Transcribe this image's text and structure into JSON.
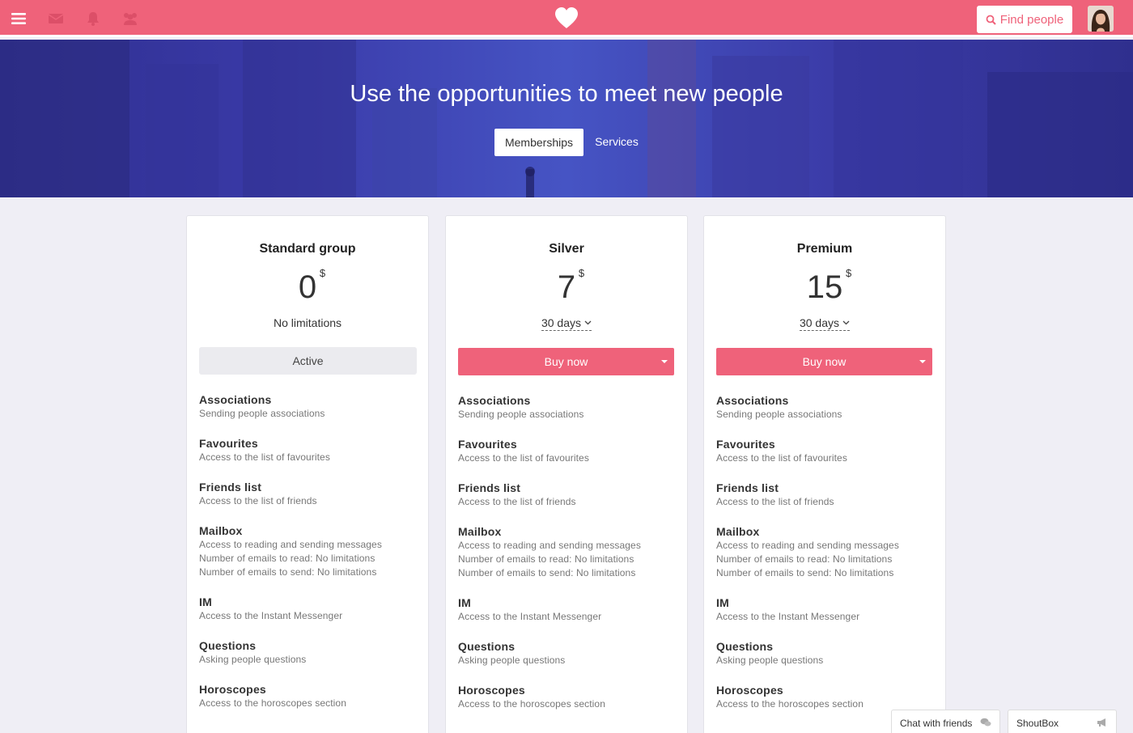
{
  "topbar": {
    "find_label": "Find people",
    "icons": [
      "menu-icon",
      "mail-icon",
      "bell-icon",
      "group-icon",
      "heart-logo-icon",
      "search-icon"
    ],
    "accent": "#ef627a"
  },
  "hero": {
    "title": "Use the opportunities to meet new people",
    "tabs": [
      {
        "label": "Memberships",
        "active": true
      },
      {
        "label": "Services",
        "active": false
      }
    ]
  },
  "plans": [
    {
      "name": "Standard group",
      "price": "0",
      "currency": "$",
      "note": "No limitations",
      "action": "Active",
      "features": [
        {
          "name": "Associations",
          "lines": [
            "Sending people associations"
          ]
        },
        {
          "name": "Favourites",
          "lines": [
            "Access to the list of favourites"
          ]
        },
        {
          "name": "Friends list",
          "lines": [
            "Access to the list of friends"
          ]
        },
        {
          "name": "Mailbox",
          "lines": [
            "Access to reading and sending messages",
            "Number of emails to read: No limitations",
            "Number of emails to send: No limitations"
          ]
        },
        {
          "name": "IM",
          "lines": [
            "Access to the Instant Messenger"
          ]
        },
        {
          "name": "Questions",
          "lines": [
            "Asking people questions"
          ]
        },
        {
          "name": "Horoscopes",
          "lines": [
            "Access to the horoscopes section"
          ]
        }
      ]
    },
    {
      "name": "Silver",
      "price": "7",
      "currency": "$",
      "period": "30 days",
      "action": "Buy now",
      "features": [
        {
          "name": "Associations",
          "lines": [
            "Sending people associations"
          ]
        },
        {
          "name": "Favourites",
          "lines": [
            "Access to the list of favourites"
          ]
        },
        {
          "name": "Friends list",
          "lines": [
            "Access to the list of friends"
          ]
        },
        {
          "name": "Mailbox",
          "lines": [
            "Access to reading and sending messages",
            "Number of emails to read: No limitations",
            "Number of emails to send: No limitations"
          ]
        },
        {
          "name": "IM",
          "lines": [
            "Access to the Instant Messenger"
          ]
        },
        {
          "name": "Questions",
          "lines": [
            "Asking people questions"
          ]
        },
        {
          "name": "Horoscopes",
          "lines": [
            "Access to the horoscopes section"
          ]
        }
      ]
    },
    {
      "name": "Premium",
      "price": "15",
      "currency": "$",
      "period": "30 days",
      "action": "Buy now",
      "features": [
        {
          "name": "Associations",
          "lines": [
            "Sending people associations"
          ]
        },
        {
          "name": "Favourites",
          "lines": [
            "Access to the list of favourites"
          ]
        },
        {
          "name": "Friends list",
          "lines": [
            "Access to the list of friends"
          ]
        },
        {
          "name": "Mailbox",
          "lines": [
            "Access to reading and sending messages",
            "Number of emails to read: No limitations",
            "Number of emails to send: No limitations"
          ]
        },
        {
          "name": "IM",
          "lines": [
            "Access to the Instant Messenger"
          ]
        },
        {
          "name": "Questions",
          "lines": [
            "Asking people questions"
          ]
        },
        {
          "name": "Horoscopes",
          "lines": [
            "Access to the horoscopes section"
          ]
        }
      ]
    }
  ],
  "bottom_tabs": {
    "chat": "Chat with friends",
    "shoutbox": "ShoutBox"
  }
}
